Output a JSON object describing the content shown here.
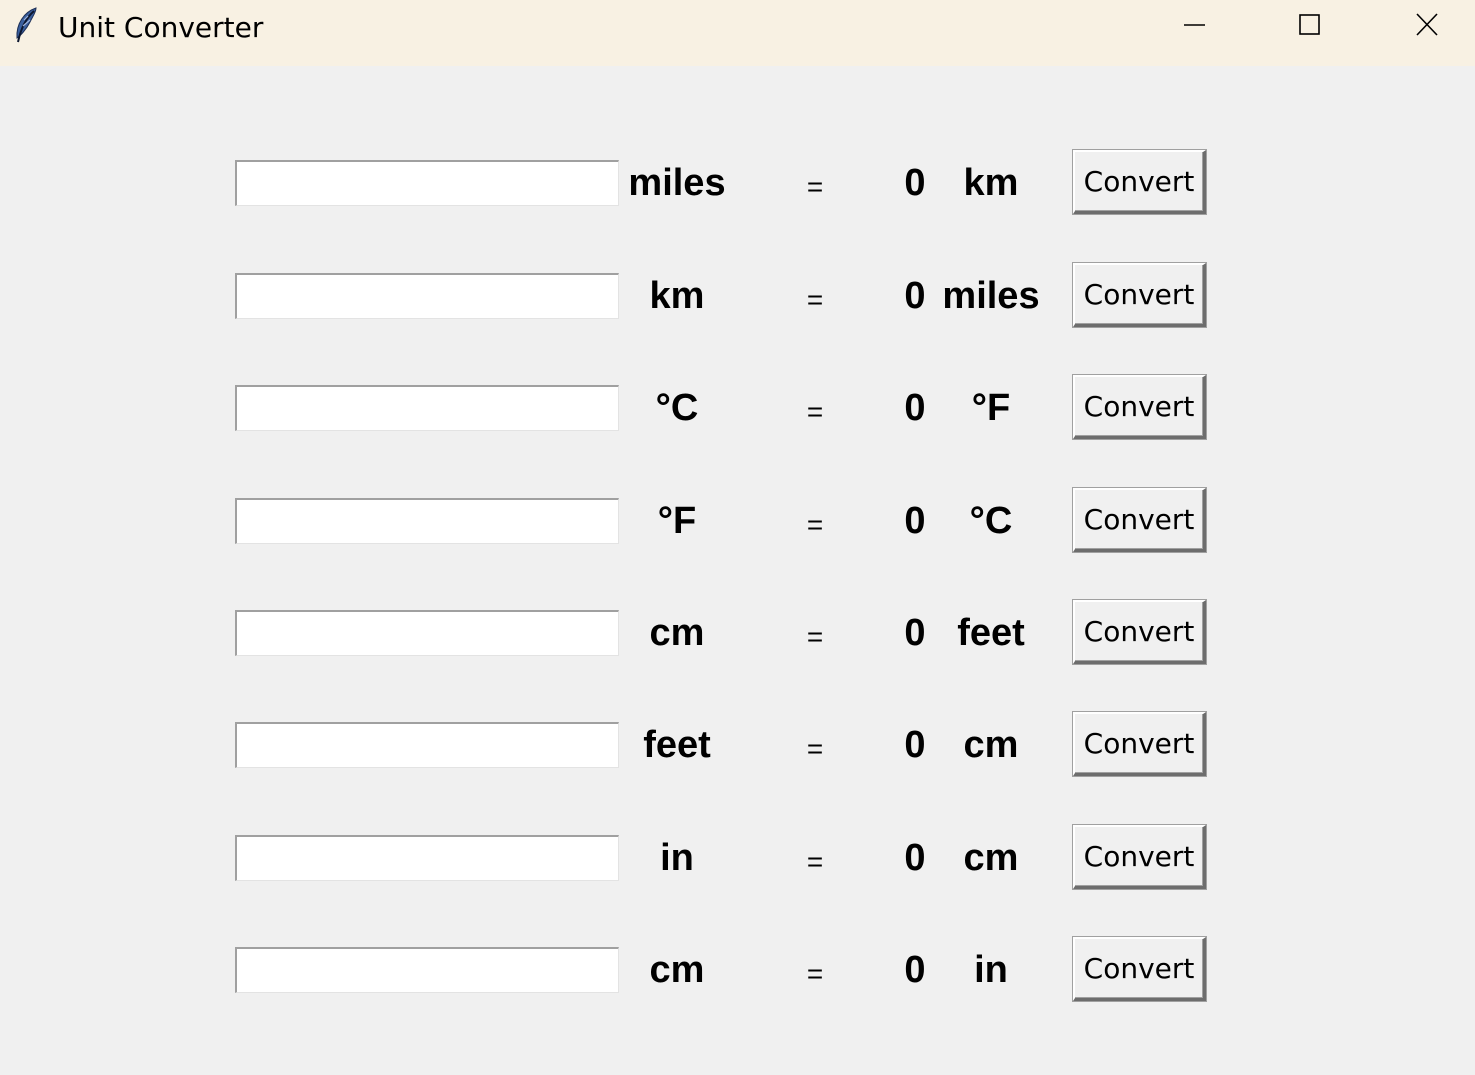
{
  "window": {
    "title": "Unit Converter",
    "icon": "feather-icon",
    "controls": [
      "minimize-icon",
      "maximize-icon",
      "close-icon"
    ]
  },
  "rows": [
    {
      "input_value": "",
      "from_unit": "miles",
      "equals": "=",
      "result": "0",
      "to_unit": "km",
      "button_label": "Convert"
    },
    {
      "input_value": "",
      "from_unit": "km",
      "equals": "=",
      "result": "0",
      "to_unit": "miles",
      "button_label": "Convert"
    },
    {
      "input_value": "",
      "from_unit": "°C",
      "equals": "=",
      "result": "0",
      "to_unit": "°F",
      "button_label": "Convert"
    },
    {
      "input_value": "",
      "from_unit": "°F",
      "equals": "=",
      "result": "0",
      "to_unit": "°C",
      "button_label": "Convert"
    },
    {
      "input_value": "",
      "from_unit": "cm",
      "equals": "=",
      "result": "0",
      "to_unit": "feet",
      "button_label": "Convert"
    },
    {
      "input_value": "",
      "from_unit": "feet",
      "equals": "=",
      "result": "0",
      "to_unit": "cm",
      "button_label": "Convert"
    },
    {
      "input_value": "",
      "from_unit": "in",
      "equals": "=",
      "result": "0",
      "to_unit": "cm",
      "button_label": "Convert"
    },
    {
      "input_value": "",
      "from_unit": "cm",
      "equals": "=",
      "result": "0",
      "to_unit": "in",
      "button_label": "Convert"
    }
  ]
}
